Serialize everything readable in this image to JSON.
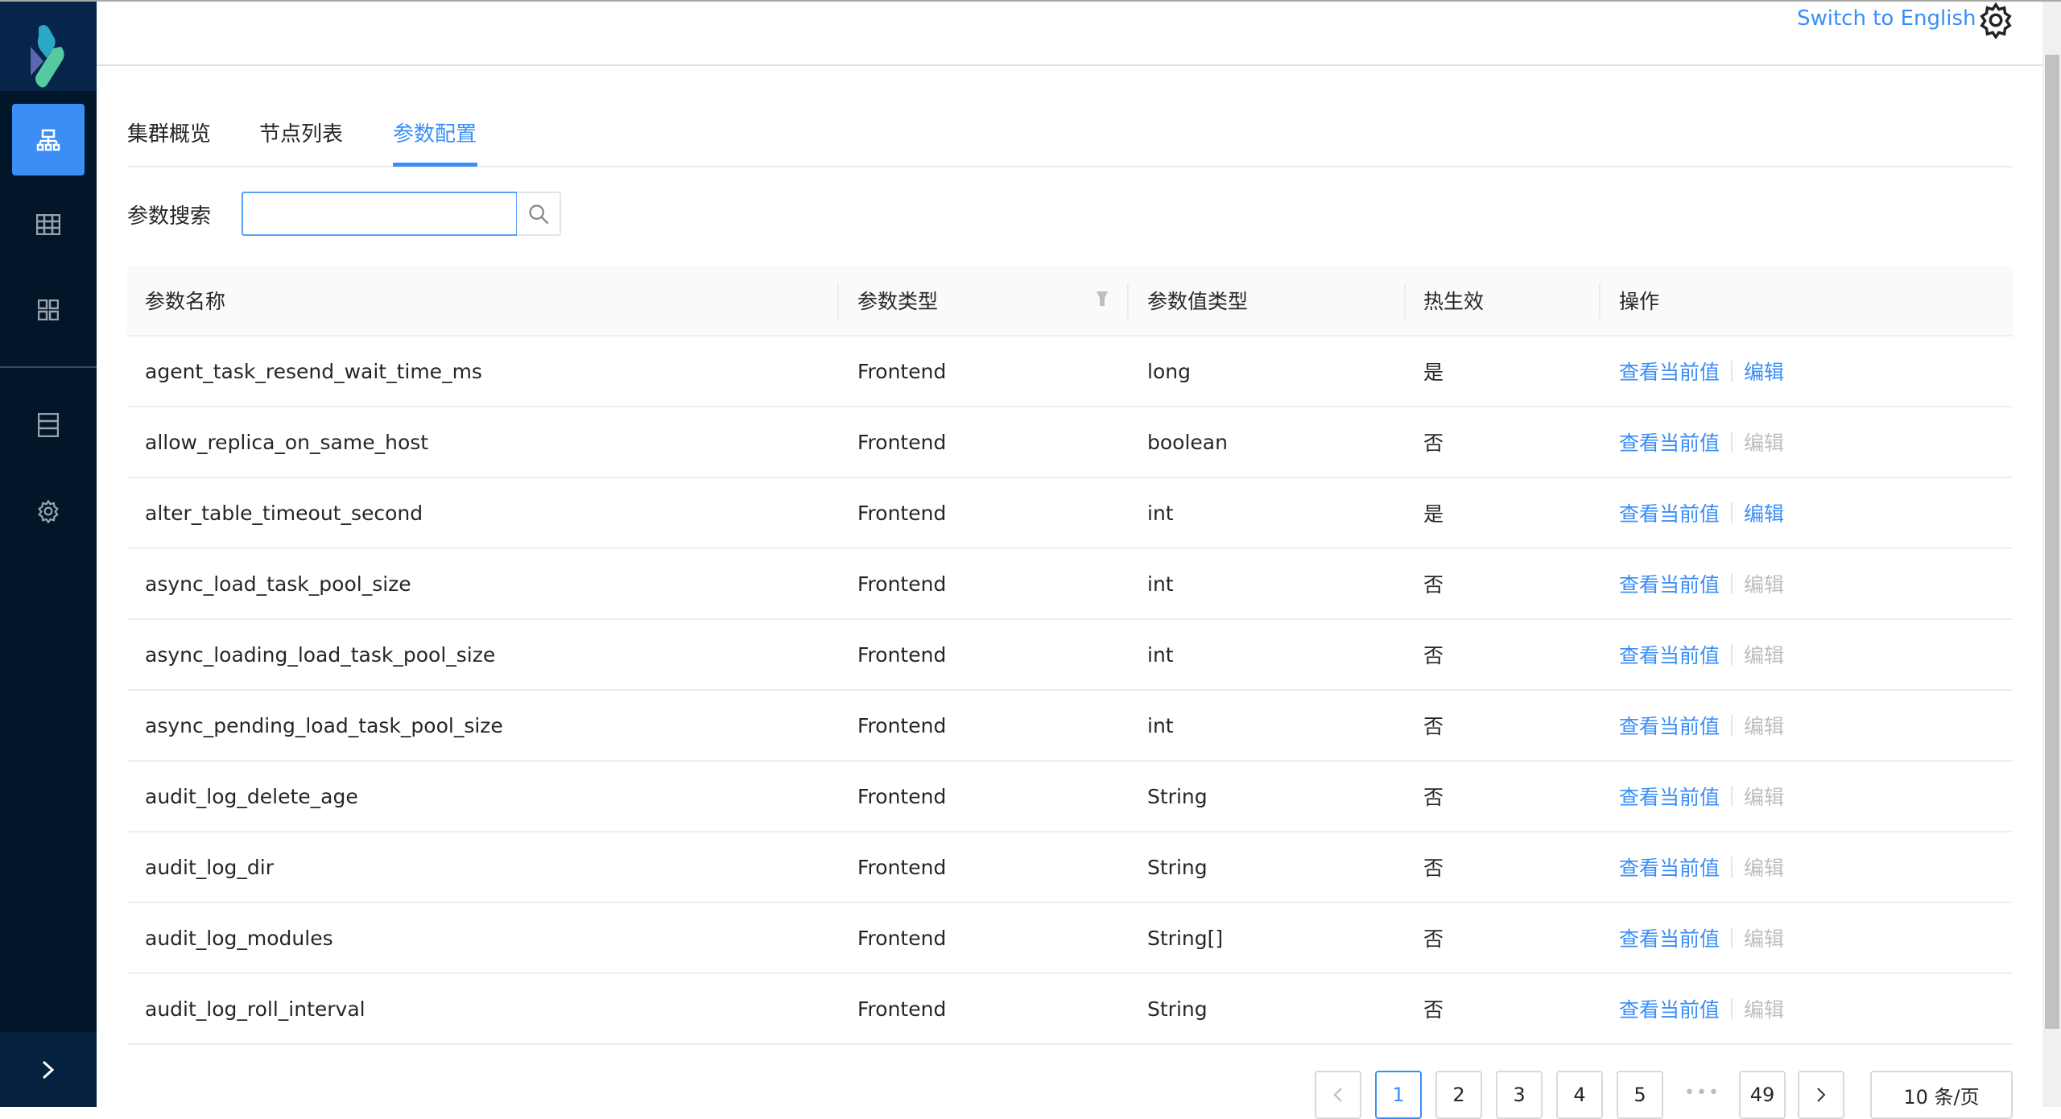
{
  "header": {
    "switch_language": "Switch to English",
    "settings_icon": "gear-icon"
  },
  "sidebar": {
    "items": [
      {
        "icon": "cluster-icon",
        "active": true
      },
      {
        "icon": "table-icon"
      },
      {
        "icon": "grid-icon"
      },
      {
        "icon": "server-icon"
      },
      {
        "icon": "gear-icon"
      }
    ],
    "toggle_icon": "chevron-right-icon"
  },
  "tabs": [
    {
      "label": "集群概览"
    },
    {
      "label": "节点列表"
    },
    {
      "label": "参数配置",
      "active": true
    }
  ],
  "search": {
    "label": "参数搜索",
    "value": "",
    "placeholder": ""
  },
  "table": {
    "columns": [
      "参数名称",
      "参数类型",
      "参数值类型",
      "热生效",
      "操作"
    ],
    "action_view": "查看当前值",
    "action_edit": "编辑",
    "rows": [
      {
        "name": "agent_task_resend_wait_time_ms",
        "type": "Frontend",
        "value_type": "long",
        "hot": "是",
        "editable": true
      },
      {
        "name": "allow_replica_on_same_host",
        "type": "Frontend",
        "value_type": "boolean",
        "hot": "否",
        "editable": false
      },
      {
        "name": "alter_table_timeout_second",
        "type": "Frontend",
        "value_type": "int",
        "hot": "是",
        "editable": true
      },
      {
        "name": "async_load_task_pool_size",
        "type": "Frontend",
        "value_type": "int",
        "hot": "否",
        "editable": false
      },
      {
        "name": "async_loading_load_task_pool_size",
        "type": "Frontend",
        "value_type": "int",
        "hot": "否",
        "editable": false
      },
      {
        "name": "async_pending_load_task_pool_size",
        "type": "Frontend",
        "value_type": "int",
        "hot": "否",
        "editable": false
      },
      {
        "name": "audit_log_delete_age",
        "type": "Frontend",
        "value_type": "String",
        "hot": "否",
        "editable": false
      },
      {
        "name": "audit_log_dir",
        "type": "Frontend",
        "value_type": "String",
        "hot": "否",
        "editable": false
      },
      {
        "name": "audit_log_modules",
        "type": "Frontend",
        "value_type": "String[]",
        "hot": "否",
        "editable": false
      },
      {
        "name": "audit_log_roll_interval",
        "type": "Frontend",
        "value_type": "String",
        "hot": "否",
        "editable": false
      }
    ]
  },
  "pagination": {
    "pages": [
      "1",
      "2",
      "3",
      "4",
      "5"
    ],
    "current": "1",
    "ellipsis": "•••",
    "last": "49",
    "page_size": "10 条/页"
  },
  "accent": "#3a8ef6"
}
